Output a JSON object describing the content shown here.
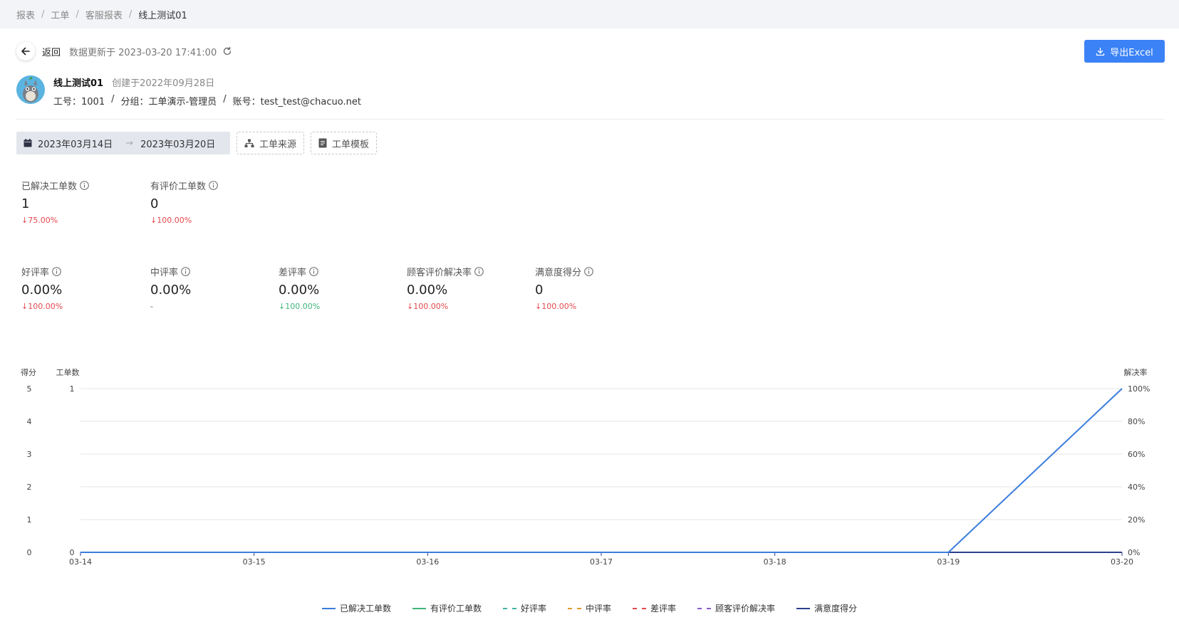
{
  "breadcrumb": [
    "报表",
    "工单",
    "客服报表",
    "线上测试01"
  ],
  "header": {
    "back_label": "返回",
    "update_text": "数据更新于 2023-03-20 17:41:00",
    "export_label": "导出Excel"
  },
  "profile": {
    "name": "线上测试01",
    "created": "创建于2022年09月28日",
    "job_no": "工号：1001",
    "group": "分组：工单演示-管理员",
    "account": "账号：test_test@chacuo.net"
  },
  "filters": {
    "start_date": "2023年03月14日",
    "end_date": "2023年03月20日",
    "source_label": "工单来源",
    "template_label": "工单模板"
  },
  "stats_row1": [
    {
      "label": "已解决工单数",
      "value": "1",
      "change": "75.00%",
      "dir": "down",
      "color": "red"
    },
    {
      "label": "有评价工单数",
      "value": "0",
      "change": "100.00%",
      "dir": "down",
      "color": "red"
    }
  ],
  "stats_row2": [
    {
      "label": "好评率",
      "value": "0.00%",
      "change": "100.00%",
      "dir": "down",
      "color": "red"
    },
    {
      "label": "中评率",
      "value": "0.00%",
      "change": "-",
      "dir": "none",
      "color": "grey"
    },
    {
      "label": "差评率",
      "value": "0.00%",
      "change": "100.00%",
      "dir": "down",
      "color": "green"
    },
    {
      "label": "顾客评价解决率",
      "value": "0.00%",
      "change": "100.00%",
      "dir": "down",
      "color": "red"
    },
    {
      "label": "满意度得分",
      "value": "0",
      "change": "100.00%",
      "dir": "down",
      "color": "red"
    }
  ],
  "chart_data": {
    "type": "line",
    "x": [
      "03-14",
      "03-15",
      "03-16",
      "03-17",
      "03-18",
      "03-19",
      "03-20"
    ],
    "axes": {
      "score": {
        "label": "得分",
        "ylim": [
          0,
          5
        ],
        "ticks": [
          "0",
          "1",
          "2",
          "3",
          "4",
          "5"
        ]
      },
      "count": {
        "label": "工单数",
        "ylim": [
          0,
          1
        ],
        "ticks": [
          "0",
          "1"
        ]
      },
      "rate": {
        "label": "解决率",
        "ylim": [
          0,
          100
        ],
        "ticks": [
          "0%",
          "20%",
          "40%",
          "60%",
          "80%",
          "100%"
        ]
      }
    },
    "series": [
      {
        "name": "已解决工单数",
        "axis": "count",
        "color": "#3b7ddd",
        "dash": "solid",
        "values": [
          0,
          0,
          0,
          0,
          0,
          0,
          1
        ]
      },
      {
        "name": "有评价工单数",
        "axis": "count",
        "color": "#3fb57a",
        "dash": "solid",
        "values": [
          0,
          0,
          0,
          0,
          0,
          0,
          0
        ]
      },
      {
        "name": "好评率",
        "axis": "rate",
        "color": "#3fb5a0",
        "dash": "dashed",
        "values": [
          0,
          0,
          0,
          0,
          0,
          0,
          0
        ]
      },
      {
        "name": "中评率",
        "axis": "rate",
        "color": "#e69a2e",
        "dash": "dashed",
        "values": [
          0,
          0,
          0,
          0,
          0,
          0,
          0
        ]
      },
      {
        "name": "差评率",
        "axis": "rate",
        "color": "#e5484d",
        "dash": "dashed",
        "values": [
          0,
          0,
          0,
          0,
          0,
          0,
          0
        ]
      },
      {
        "name": "顾客评价解决率",
        "axis": "rate",
        "color": "#8a5cc9",
        "dash": "dashed",
        "values": [
          0,
          0,
          0,
          0,
          0,
          0,
          0
        ]
      },
      {
        "name": "满意度得分",
        "axis": "score",
        "color": "#2c3e8f",
        "dash": "solid",
        "values": [
          0,
          0,
          0,
          0,
          0,
          0,
          0
        ]
      }
    ],
    "grid": true,
    "legend": "bottom-center"
  }
}
